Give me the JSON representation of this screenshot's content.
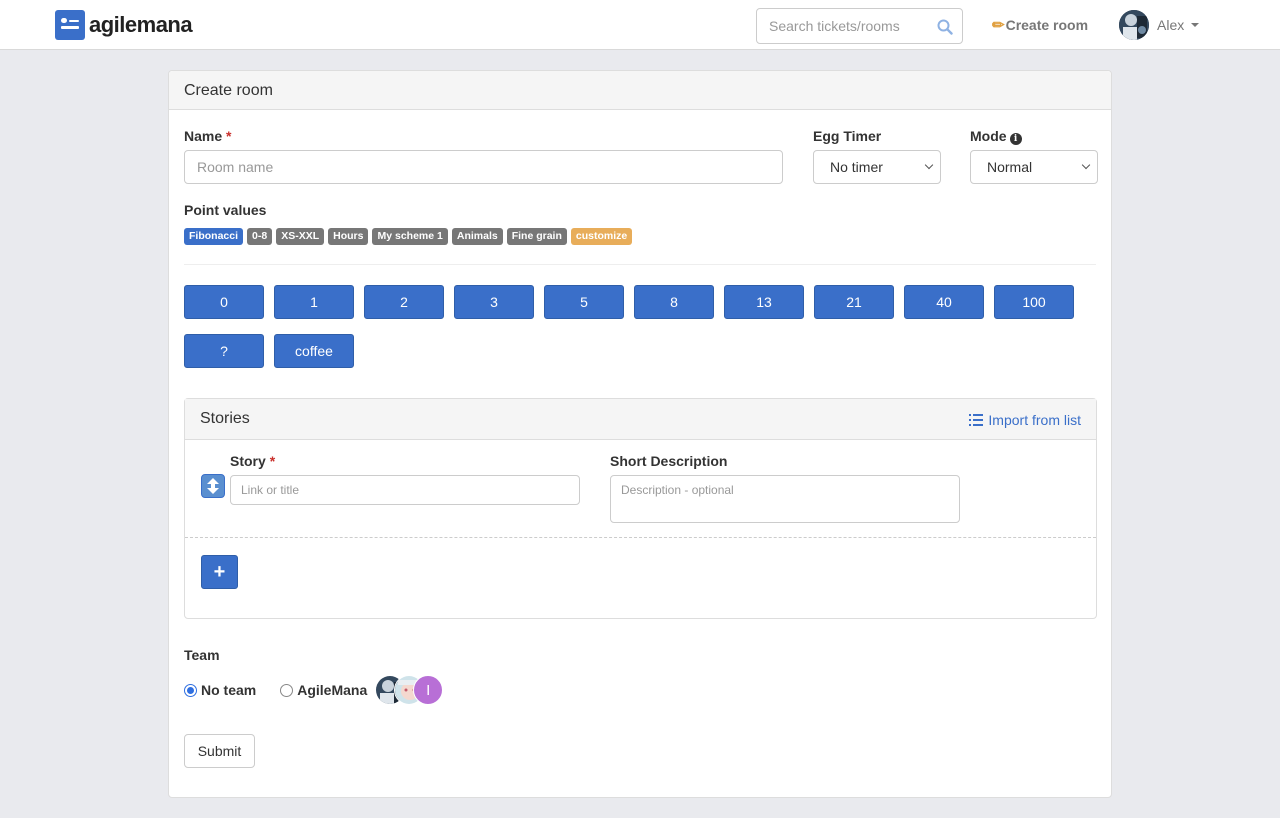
{
  "navbar": {
    "brand": "agilemana",
    "search_placeholder": "Search tickets/rooms",
    "create_room": "Create room",
    "user_name": "Alex"
  },
  "panel": {
    "title": "Create room"
  },
  "form": {
    "name_label": "Name",
    "required_mark": "*",
    "name_placeholder": "Room name",
    "egg_timer_label": "Egg Timer",
    "egg_timer_value": "No timer",
    "mode_label": "Mode",
    "mode_value": "Normal",
    "point_values_label": "Point values",
    "schemes": [
      "Fibonacci",
      "0-8",
      "XS-XXL",
      "Hours",
      "My scheme 1",
      "Animals",
      "Fine grain",
      "customize"
    ],
    "selected_scheme": "Fibonacci",
    "points": [
      "0",
      "1",
      "2",
      "3",
      "5",
      "8",
      "13",
      "21",
      "40",
      "100",
      "?",
      "coffee"
    ]
  },
  "stories": {
    "title": "Stories",
    "import_link": "Import from list",
    "story_label": "Story",
    "story_placeholder": "Link or title",
    "desc_label": "Short Description",
    "desc_placeholder": "Description - optional",
    "add_label": "+"
  },
  "team": {
    "label": "Team",
    "options": [
      "No team",
      "AgileMana"
    ],
    "selected": "No team",
    "member_initial": "I"
  },
  "submit_label": "Submit",
  "colors": {
    "primary": "#3a6fc9",
    "label_default": "#777777",
    "label_warning": "#e8ad5a",
    "required": "#c9302c"
  }
}
